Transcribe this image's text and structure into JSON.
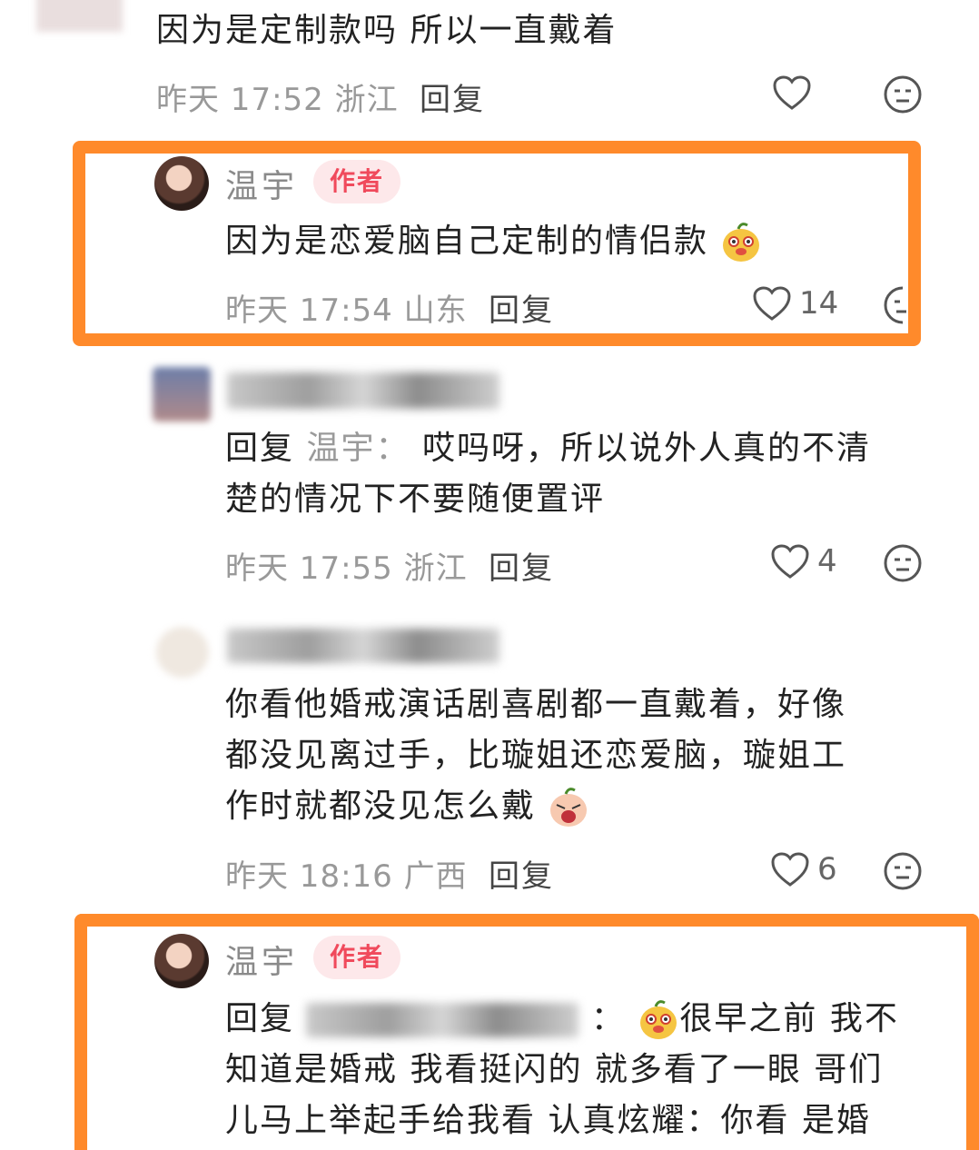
{
  "comments": [
    {
      "body": "因为是定制款吗 所以一直戴着",
      "time": "昨天 17:52",
      "location": "浙江",
      "reply_label": "回复"
    },
    {
      "author": "温宇",
      "badge": "作者",
      "body": "因为是恋爱脑自己定制的情侣款",
      "emoji": "smiling-mango-emoji",
      "time": "昨天 17:54",
      "location": "山东",
      "reply_label": "回复",
      "likes": "14"
    },
    {
      "reply_prefix": "回复",
      "reply_to": "温宇：",
      "body_line1": "哎吗呀，所以说外人真的不清",
      "body_line2": "楚的情况下不要随便置评",
      "time": "昨天 17:55",
      "location": "浙江",
      "reply_label": "回复",
      "likes": "4"
    },
    {
      "body_line1": "你看他婚戒演话剧喜剧都一直戴着，好像",
      "body_line2": "都没见离过手，比璇姐还恋爱脑，璇姐工",
      "body_line3": "作时就都没见怎么戴",
      "emoji": "crying-mango-emoji",
      "time": "昨天 18:16",
      "location": "广西",
      "reply_label": "回复",
      "likes": "6"
    },
    {
      "author": "温宇",
      "badge": "作者",
      "reply_prefix": "回复",
      "colon": "：",
      "body_line1": "很早之前 我不",
      "body_line2": "知道是婚戒 我看挺闪的 就多看了一眼 哥们",
      "body_line3": "儿马上举起手给我看 认真炫耀：你看 是婚",
      "emoji": "smiling-mango-emoji"
    }
  ],
  "colors": {
    "highlight_frame": "#ff8a2b",
    "author_badge_bg": "#fde8ea",
    "author_badge_text": "#f04a5c"
  }
}
